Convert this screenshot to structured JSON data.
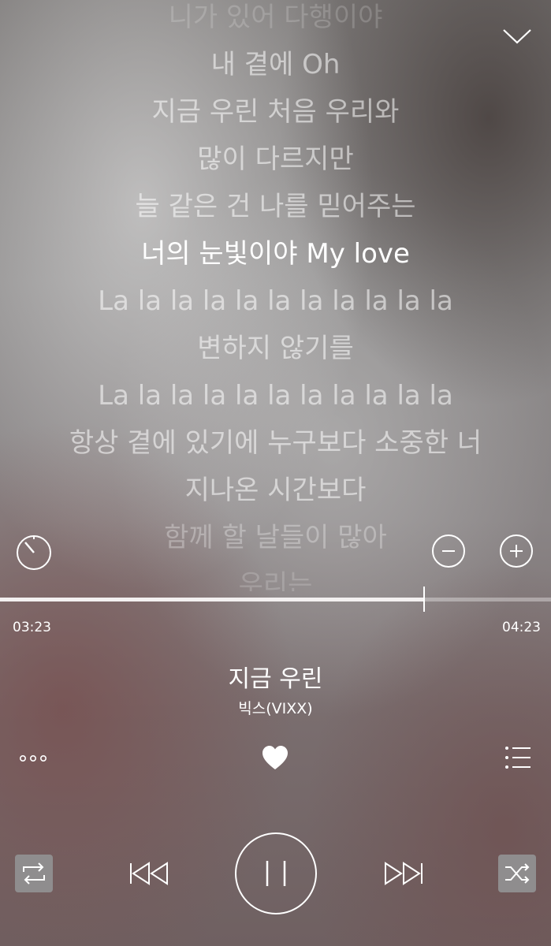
{
  "lyrics": {
    "lines": [
      "니가 있어 다행이야",
      "내 곁에 Oh",
      "지금 우린 처음 우리와",
      "많이 다르지만",
      "늘 같은 건 나를 믿어주는",
      "너의 눈빛이야 My love",
      "La la la la la la la la la la la",
      "변하지 않기를",
      "La la la la la la la la la la la",
      "항상 곁에 있기에 누구보다 소중한 너",
      "지나온 시간보다",
      "함께 할 날들이 많아",
      "우리는"
    ],
    "current_index": 5
  },
  "icons": {
    "collapse": "chevron-down-icon",
    "timer": "sleep-timer-icon",
    "font_decrease": "minus-icon",
    "font_increase": "plus-icon",
    "more": "more-dots-icon",
    "like": "heart-icon",
    "playlist": "playlist-icon",
    "repeat": "repeat-icon",
    "previous": "previous-icon",
    "pause": "pause-icon",
    "next": "next-icon",
    "shuffle": "shuffle-icon"
  },
  "player": {
    "elapsed": "03:23",
    "duration": "04:23",
    "progress": 0.77,
    "title": "지금 우린",
    "artist": "빅스(VIXX)",
    "pause_glyph": "| |"
  },
  "colors": {
    "accent": "#ffffff",
    "active_control_bg": "#8f8d8e"
  }
}
